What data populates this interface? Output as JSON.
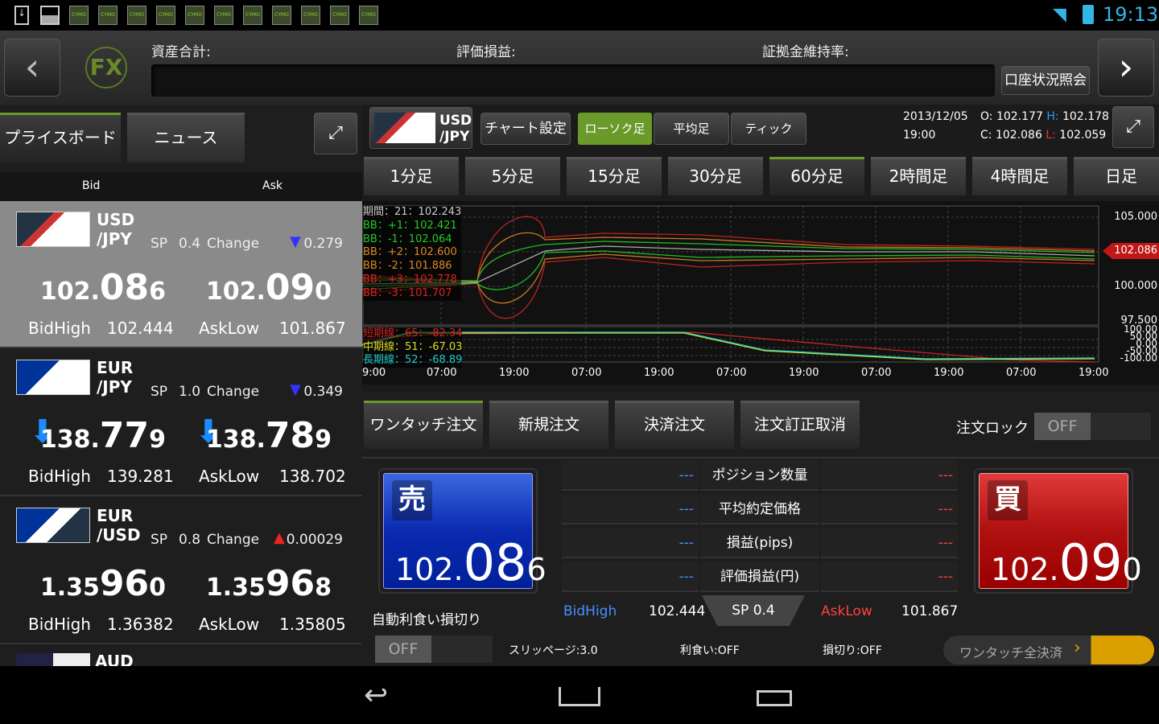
{
  "status": {
    "time": "19:13",
    "notification_icons": [
      "download-icon",
      "image-icon",
      "cymo-app-icon",
      "cymo-app-icon",
      "cymo-app-icon",
      "cymo-app-icon",
      "cymo-app-icon",
      "cymo-app-icon",
      "cymo-app-icon",
      "cymo-app-icon",
      "cymo-app-icon",
      "cymo-app-icon",
      "cymo-app-icon"
    ],
    "cymo_label": "CYMO"
  },
  "header": {
    "logo": "FX",
    "total_assets_label": "資産合計:",
    "valuation_pl_label": "評価損益:",
    "margin_ratio_label": "証拠金維持率:",
    "account_button": "口座状況照会"
  },
  "left": {
    "tabs": [
      "プライスボード",
      "ニュース"
    ],
    "bid_label": "Bid",
    "ask_label": "Ask",
    "rows": [
      {
        "base": "USD",
        "quote": "/JPY",
        "sp_label": "SP",
        "sp": "0.4",
        "change_label": "Change",
        "change_dir": "down",
        "change": "0.279",
        "bid_main": "102.",
        "bid_big": "08",
        "bid_tail": "6",
        "ask_main": "102.",
        "ask_big": "09",
        "ask_tail": "0",
        "bidhigh_label": "BidHigh",
        "bidhigh": "102.444",
        "asklow_label": "AskLow",
        "asklow": "101.867"
      },
      {
        "base": "EUR",
        "quote": "/JPY",
        "sp_label": "SP",
        "sp": "1.0",
        "change_label": "Change",
        "change_dir": "down",
        "change": "0.349",
        "bid_main": "138.",
        "bid_big": "77",
        "bid_tail": "9",
        "ask_main": "138.",
        "ask_big": "78",
        "ask_tail": "9",
        "bidhigh_label": "BidHigh",
        "bidhigh": "139.281",
        "asklow_label": "AskLow",
        "asklow": "138.702"
      },
      {
        "base": "EUR",
        "quote": "/USD",
        "sp_label": "SP",
        "sp": "0.8",
        "change_label": "Change",
        "change_dir": "up",
        "change": "0.00029",
        "bid_main": "1.35",
        "bid_big": "96",
        "bid_tail": "0",
        "ask_main": "1.35",
        "ask_big": "96",
        "ask_tail": "8",
        "bidhigh_label": "BidHigh",
        "bidhigh": "1.36382",
        "asklow_label": "AskLow",
        "asklow": "1.35805"
      }
    ],
    "partial_row": "AUD"
  },
  "chart_header": {
    "base": "USD",
    "quote": "/JPY",
    "settings": "チャート設定",
    "types": [
      "ローソク足",
      "平均足",
      "ティック"
    ],
    "date": "2013/12/05",
    "time": "19:00",
    "o_label": "O:",
    "o": "102.177",
    "h_label": "H:",
    "h": "102.178",
    "c_label": "C:",
    "c": "102.086",
    "l_label": "L:",
    "l": "102.059"
  },
  "timeframes": [
    "1分足",
    "5分足",
    "15分足",
    "30分足",
    "60分足",
    "2時間足",
    "4時間足",
    "日足"
  ],
  "chart": {
    "legend": [
      "期間：21：102.243",
      "BB：+1：102.421",
      "BB：-1：102.064",
      "BB：+2：102.600",
      "BB：-2：101.886",
      "BB：+3：102.778",
      "BB：-3：101.707"
    ],
    "osc_legend": [
      "短期線：65：-82.34",
      "中期線：51：-67.03",
      "長期線：52：-68.89"
    ],
    "y_ticks": [
      "105.000",
      "100.000",
      "97.500"
    ],
    "current_price": "102.086",
    "osc_ticks": [
      "100.00",
      "50.00",
      "0.00",
      "-50.00",
      "-100.00"
    ],
    "x_ticks": [
      "9:00",
      "07:00",
      "19:00",
      "07:00",
      "19:00",
      "07:00",
      "19:00",
      "07:00",
      "19:00",
      "07:00",
      "19:00"
    ],
    "colors": {
      "mid": "#aaaaaa",
      "bb1": "#22bb22",
      "bb2": "#cc7722",
      "bb3": "#cc2222",
      "osc_short": "#cc2222",
      "osc_mid": "#dddd22",
      "osc_long": "#22cccc"
    }
  },
  "order": {
    "tabs": [
      "ワンタッチ注文",
      "新規注文",
      "決済注文",
      "注文訂正取消"
    ],
    "lock_label": "注文ロック",
    "lock_state": "OFF",
    "sell_label": "売",
    "sell_main": "102.",
    "sell_big": "08",
    "sell_tail": "6",
    "buy_label": "買",
    "buy_main": "102.",
    "buy_big": "09",
    "buy_tail": "0",
    "table": [
      {
        "left": "---",
        "label": "ポジション数量",
        "right": "---"
      },
      {
        "left": "---",
        "label": "平均約定価格",
        "right": "---"
      },
      {
        "left": "---",
        "label": "損益(pips)",
        "right": "---"
      },
      {
        "left": "---",
        "label": "評価損益(円)",
        "right": "---"
      }
    ],
    "bidhigh_label": "BidHigh",
    "bidhigh": "102.444",
    "sp": "SP 0.4",
    "asklow_label": "AskLow",
    "asklow": "101.867",
    "auto_label": "自動利食い損切り",
    "auto_state": "OFF",
    "slippage": "スリッページ:3.0",
    "take_profit": "利食い:OFF",
    "stop_loss": "損切り:OFF",
    "close_all": "ワンタッチ全決済"
  }
}
